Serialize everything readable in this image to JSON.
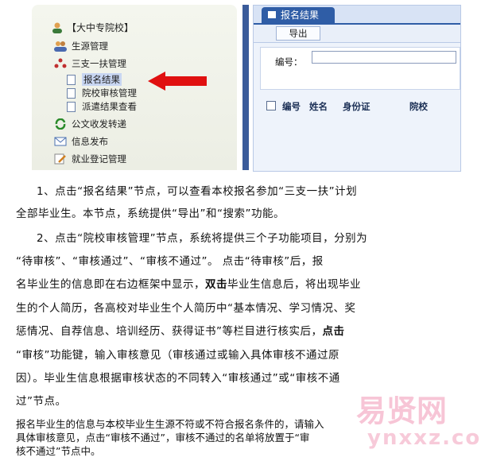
{
  "sidebar": {
    "title": "【大中专院校】",
    "items": [
      {
        "label": "生源管理"
      },
      {
        "label": "三支一扶管理"
      },
      {
        "label": "公文收发转递"
      },
      {
        "label": "信息发布"
      },
      {
        "label": "就业登记管理"
      }
    ],
    "subitems": [
      {
        "label": "报名结果"
      },
      {
        "label": "院校审核管理"
      },
      {
        "label": "派遣结果查看"
      }
    ]
  },
  "panel": {
    "tab_label": "报名结果",
    "export_label": "导出",
    "number_label": "编号：",
    "columns": [
      "编号",
      "姓名",
      "身份证",
      "院校"
    ]
  },
  "text": {
    "p1_line1": "1、点击“报名结果”节点，可以查看本校报名参加“三支一扶”计划",
    "p1_line2": "全部毕业生。本节点，系统提供“导出”和“搜索”功能。",
    "p2_line1": "2、点击“院校审核管理”节点，系统将提供三个子功能项目，分别为",
    "p2_line2": "“待审核”、“审核通过”、“审核不通过”。 点击“待审核”后，报",
    "p2_line3a": "名毕业生的信息即在右边框架中显示，",
    "p2_line3b": "双击",
    "p2_line3c": "毕业生信息后，将出现毕业",
    "p2_line4": "生的个人简历，各高校对毕业生个人简历中“基本情况、学习情况、奖",
    "p2_line5": "惩情况、自荐信息、培训经历、获得证书”等栏目进行核实后，",
    "p2_line5b": "点击",
    "p2_line6": "“审核”功能键，输入审核意见（审核通过或输入具体审核不通过原",
    "p2_line7": "因）。毕业生信息根据审核状态的不同转入“审核通过”或“审核不通",
    "p2_line8": "过”节点。",
    "s1": "报名毕业生的信息与本校毕业生生源不符或不符合报名条件的，请输入",
    "s2": "具体审核意见，点击“审核不通过”，审核不通过的名单将放置于“审",
    "s3": "核不通过”节点中。"
  },
  "watermark": {
    "brand": "易贤网",
    "url": "ynxxz.com"
  }
}
